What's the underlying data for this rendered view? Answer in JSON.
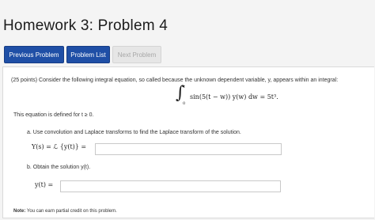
{
  "header": {
    "title": "Homework 3: Problem 4"
  },
  "nav": {
    "previous": "Previous Problem",
    "list": "Problem List",
    "next": "Next Problem"
  },
  "problem": {
    "intro": "(25 points) Consider the following integral equation, so called because the unknown dependent variable, y, appears within an integral:",
    "equation": {
      "integral": "∫",
      "upper": "t",
      "lower": "0",
      "body": "sin(5(t − w)) y(w) dw = 5t³."
    },
    "domain": "This equation is defined for t ≥ 0.",
    "part_a": {
      "text": "a. Use convolution and Laplace transforms to find the Laplace transform of the solution.",
      "label": "Y(s) = ℒ {y(t)} ="
    },
    "part_b": {
      "text": "b. Obtain the solution y(t).",
      "label": "y(t) ="
    },
    "note_label": "Note:",
    "note_text": " You can earn partial credit on this problem."
  }
}
